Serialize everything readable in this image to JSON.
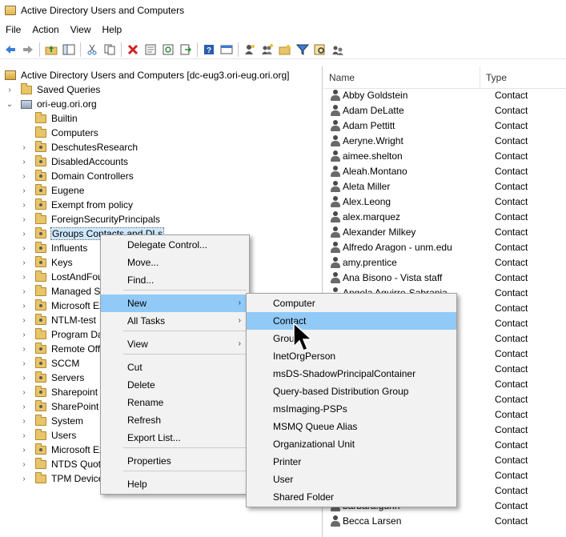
{
  "window": {
    "title": "Active Directory Users and Computers"
  },
  "menubar": {
    "items": [
      "File",
      "Action",
      "View",
      "Help"
    ]
  },
  "toolbar": {
    "icons": [
      "back-icon",
      "forward-icon",
      "up-folder-icon",
      "show-hide-tree-icon",
      "cut-icon",
      "copy-icon",
      "delete-icon",
      "properties-icon",
      "refresh-icon",
      "export-icon",
      "help-icon",
      "console-view-icon",
      "new-user-icon",
      "new-group-icon",
      "new-ou-icon",
      "filter-icon",
      "find-icon",
      "add-to-group-icon"
    ]
  },
  "tree": {
    "root_label": "Active Directory Users and Computers [dc-eug3.ori-eug.ori.org]",
    "saved_queries": "Saved Queries",
    "domain": "ori-eug.ori.org",
    "items": [
      {
        "label": "Builtin",
        "ou": false,
        "expandable": false
      },
      {
        "label": "Computers",
        "ou": false,
        "expandable": false
      },
      {
        "label": "DeschutesResearch",
        "ou": true,
        "expandable": true
      },
      {
        "label": "DisabledAccounts",
        "ou": true,
        "expandable": true
      },
      {
        "label": "Domain Controllers",
        "ou": true,
        "expandable": true
      },
      {
        "label": "Eugene",
        "ou": true,
        "expandable": true
      },
      {
        "label": "Exempt from policy",
        "ou": true,
        "expandable": true
      },
      {
        "label": "ForeignSecurityPrincipals",
        "ou": false,
        "expandable": true
      },
      {
        "label": "Groups Contacts and DLs",
        "ou": true,
        "expandable": true,
        "selected": true
      },
      {
        "label": "Influents",
        "ou": true,
        "expandable": true
      },
      {
        "label": "Keys",
        "ou": true,
        "expandable": true
      },
      {
        "label": "LostAndFound",
        "ou": false,
        "expandable": true
      },
      {
        "label": "Managed Service Accounts",
        "ou": false,
        "expandable": true
      },
      {
        "label": "Microsoft Exchange",
        "ou": true,
        "expandable": true
      },
      {
        "label": "NTLM-test",
        "ou": true,
        "expandable": true
      },
      {
        "label": "Program Data",
        "ou": false,
        "expandable": true
      },
      {
        "label": "Remote Office",
        "ou": true,
        "expandable": true
      },
      {
        "label": "SCCM",
        "ou": true,
        "expandable": true
      },
      {
        "label": "Servers",
        "ou": true,
        "expandable": true
      },
      {
        "label": "Sharepoint",
        "ou": true,
        "expandable": true
      },
      {
        "label": "SharePoint",
        "ou": true,
        "expandable": true
      },
      {
        "label": "System",
        "ou": false,
        "expandable": true
      },
      {
        "label": "Users",
        "ou": false,
        "expandable": true
      },
      {
        "label": "Microsoft Exchange",
        "ou": true,
        "expandable": true
      },
      {
        "label": "NTDS Quotas",
        "ou": false,
        "expandable": true
      },
      {
        "label": "TPM Devices",
        "ou": false,
        "expandable": true
      }
    ]
  },
  "list": {
    "columns": {
      "name": "Name",
      "type": "Type"
    },
    "rows": [
      {
        "name": "Abby Goldstein",
        "type": "Contact"
      },
      {
        "name": "Adam DeLatte",
        "type": "Contact"
      },
      {
        "name": "Adam Pettitt",
        "type": "Contact"
      },
      {
        "name": "Aeryne.Wright",
        "type": "Contact"
      },
      {
        "name": "aimee.shelton",
        "type": "Contact"
      },
      {
        "name": "Aleah.Montano",
        "type": "Contact"
      },
      {
        "name": "Aleta Miller",
        "type": "Contact"
      },
      {
        "name": "Alex.Leong",
        "type": "Contact"
      },
      {
        "name": "alex.marquez",
        "type": "Contact"
      },
      {
        "name": "Alexander Milkey",
        "type": "Contact"
      },
      {
        "name": "Alfredo Aragon - unm.edu",
        "type": "Contact"
      },
      {
        "name": "amy.prentice",
        "type": "Contact"
      },
      {
        "name": "Ana Bisono - Vista staff",
        "type": "Contact"
      },
      {
        "name": "Angela Aguirre-Sabrania",
        "type": "Contact"
      },
      {
        "name": "",
        "type": "Contact"
      },
      {
        "name": "",
        "type": "Contact"
      },
      {
        "name": "",
        "type": "Contact"
      },
      {
        "name": "",
        "type": "Contact"
      },
      {
        "name": "",
        "type": "Contact"
      },
      {
        "name": "",
        "type": "Contact"
      },
      {
        "name": "",
        "type": "Contact"
      },
      {
        "name": "",
        "type": "Contact"
      },
      {
        "name": "",
        "type": "Contact"
      },
      {
        "name": "",
        "type": "Contact"
      },
      {
        "name": "",
        "type": "Contact"
      },
      {
        "name": "",
        "type": "Contact"
      },
      {
        "name": "",
        "type": "Contact"
      },
      {
        "name": "barbara.gunn",
        "type": "Contact"
      },
      {
        "name": "Becca Larsen",
        "type": "Contact"
      }
    ]
  },
  "context_menu": {
    "items": [
      "Delegate Control...",
      "Move...",
      "Find...",
      "New",
      "All Tasks",
      "View",
      "Cut",
      "Delete",
      "Rename",
      "Refresh",
      "Export List...",
      "Properties",
      "Help"
    ],
    "highlighted": "New"
  },
  "submenu": {
    "items": [
      "Computer",
      "Contact",
      "Group",
      "InetOrgPerson",
      "msDS-ShadowPrincipalContainer",
      "Query-based Distribution Group",
      "msImaging-PSPs",
      "MSMQ Queue Alias",
      "Organizational Unit",
      "Printer",
      "User",
      "Shared Folder"
    ],
    "highlighted": "Contact"
  },
  "colors": {
    "highlight": "#91c9f7",
    "selection": "#cce8ff",
    "menu_bg": "#f2f2f2"
  }
}
